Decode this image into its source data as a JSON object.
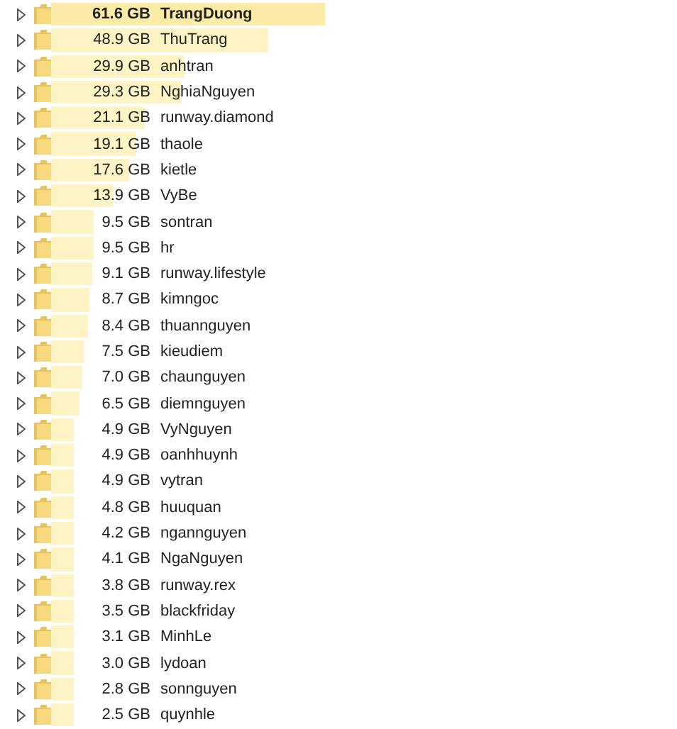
{
  "folders": [
    {
      "size": "61.6 GB",
      "name": "TrangDuong",
      "selected": true,
      "expanded": false
    },
    {
      "size": "48.9 GB",
      "name": "ThuTrang",
      "selected": false,
      "expanded": false
    },
    {
      "size": "29.9 GB",
      "name": "anhtran",
      "selected": false,
      "expanded": false
    },
    {
      "size": "29.3 GB",
      "name": "NghiaNguyen",
      "selected": false,
      "expanded": false
    },
    {
      "size": "21.1 GB",
      "name": "runway.diamond",
      "selected": false,
      "expanded": false
    },
    {
      "size": "19.1 GB",
      "name": "thaole",
      "selected": false,
      "expanded": false
    },
    {
      "size": "17.6 GB",
      "name": "kietle",
      "selected": false,
      "expanded": false
    },
    {
      "size": "13.9 GB",
      "name": "VyBe",
      "selected": false,
      "expanded": false
    },
    {
      "size": "9.5 GB",
      "name": "sontran",
      "selected": false,
      "expanded": false
    },
    {
      "size": "9.5 GB",
      "name": "hr",
      "selected": false,
      "expanded": false
    },
    {
      "size": "9.1 GB",
      "name": "runway.lifestyle",
      "selected": false,
      "expanded": false
    },
    {
      "size": "8.7 GB",
      "name": "kimngoc",
      "selected": false,
      "expanded": false
    },
    {
      "size": "8.4 GB",
      "name": "thuannguyen",
      "selected": false,
      "expanded": false
    },
    {
      "size": "7.5 GB",
      "name": "kieudiem",
      "selected": false,
      "expanded": false
    },
    {
      "size": "7.0 GB",
      "name": "chaunguyen",
      "selected": false,
      "expanded": false
    },
    {
      "size": "6.5 GB",
      "name": "diemnguyen",
      "selected": false,
      "expanded": false
    },
    {
      "size": "4.9 GB",
      "name": "VyNguyen",
      "selected": false,
      "expanded": false
    },
    {
      "size": "4.9 GB",
      "name": "oanhhuynh",
      "selected": false,
      "expanded": false
    },
    {
      "size": "4.9 GB",
      "name": "vytran",
      "selected": false,
      "expanded": false
    },
    {
      "size": "4.8 GB",
      "name": "huuquan",
      "selected": false,
      "expanded": false
    },
    {
      "size": "4.2 GB",
      "name": "ngannguyen",
      "selected": false,
      "expanded": false
    },
    {
      "size": "4.1 GB",
      "name": "NgaNguyen",
      "selected": false,
      "expanded": false
    },
    {
      "size": "3.8 GB",
      "name": "runway.rex",
      "selected": false,
      "expanded": false
    },
    {
      "size": "3.5 GB",
      "name": "blackfriday",
      "selected": false,
      "expanded": false
    },
    {
      "size": "3.1 GB",
      "name": "MinhLe",
      "selected": false,
      "expanded": false
    },
    {
      "size": "3.0 GB",
      "name": "lydoan",
      "selected": false,
      "expanded": false
    },
    {
      "size": "2.8 GB",
      "name": "sonnguyen",
      "selected": false,
      "expanded": false
    },
    {
      "size": "2.5 GB",
      "name": "quynhle",
      "selected": false,
      "expanded": false
    }
  ]
}
